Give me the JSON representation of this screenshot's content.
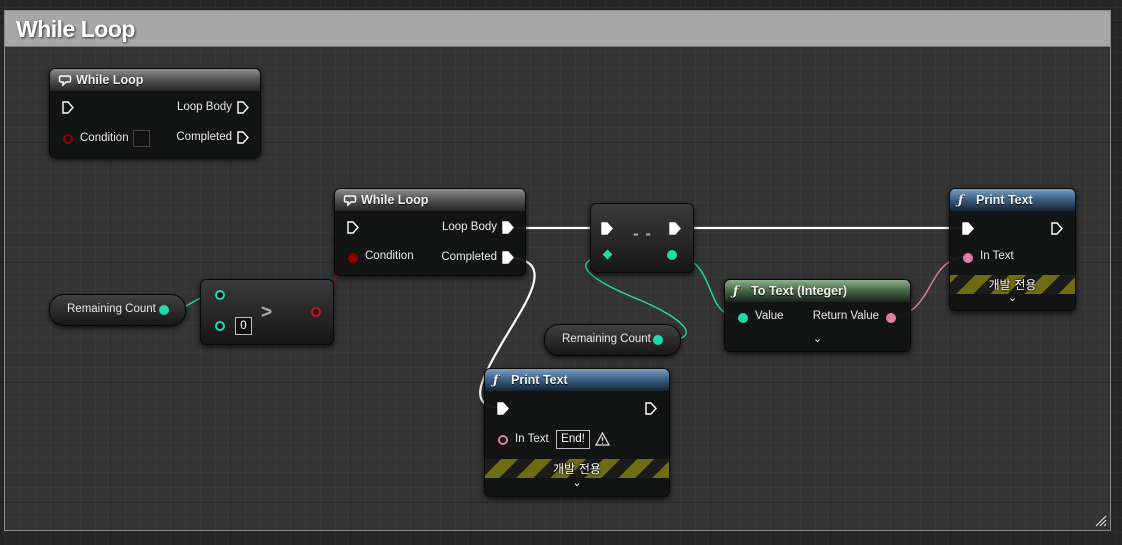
{
  "comment": {
    "title": "While Loop"
  },
  "node_while_loop_unconnected": {
    "title": "While Loop",
    "pins": {
      "condition": "Condition",
      "loop_body": "Loop Body",
      "completed": "Completed"
    }
  },
  "node_while_loop": {
    "title": "While Loop",
    "pins": {
      "condition": "Condition",
      "loop_body": "Loop Body",
      "completed": "Completed"
    }
  },
  "node_greater": {
    "operator": ">",
    "b_value": "0"
  },
  "node_decrement": {
    "operator": "- -"
  },
  "var_remaining_count_1": {
    "label": "Remaining Count"
  },
  "var_remaining_count_2": {
    "label": "Remaining Count"
  },
  "node_to_text": {
    "title": "To Text (Integer)",
    "pins": {
      "value": "Value",
      "return_value": "Return Value"
    }
  },
  "node_print_text_top": {
    "title": "Print Text",
    "pins": {
      "in_text": "In Text"
    },
    "dev_only": "개발 전용"
  },
  "node_print_text_bottom": {
    "title": "Print Text",
    "pins": {
      "in_text": "In Text"
    },
    "in_text_value": "End!",
    "dev_only": "개발 전용"
  },
  "colors": {
    "exec_wire": "#ffffff",
    "int_pin": "#1edcaa",
    "bool_pin": "#8c0000",
    "text_pin": "#e07fa8"
  },
  "icons": [
    "loop-icon",
    "function-icon",
    "warning-icon",
    "chevron-down-icon",
    "exec-pin-icon"
  ]
}
